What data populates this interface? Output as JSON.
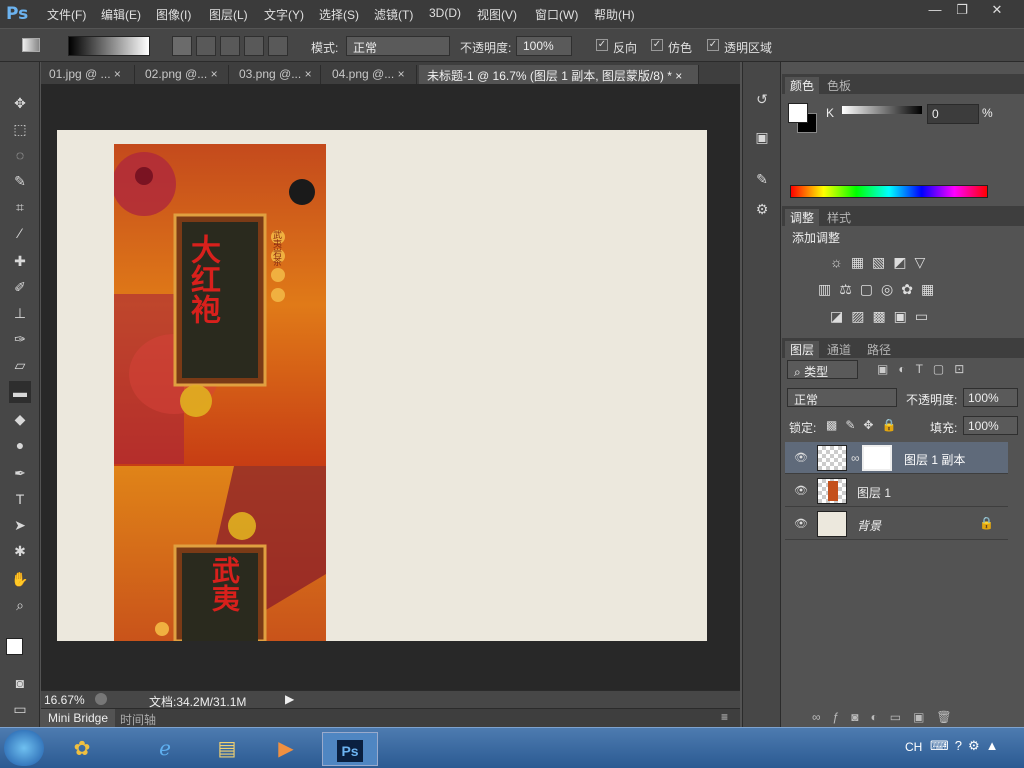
{
  "app": {
    "logo": "Ps"
  },
  "menu": [
    "文件(F)",
    "编辑(E)",
    "图像(I)",
    "图层(L)",
    "文字(Y)",
    "选择(S)",
    "滤镜(T)",
    "3D(D)",
    "视图(V)",
    "窗口(W)",
    "帮助(H)"
  ],
  "window_controls": {
    "minimize": "—",
    "restore": "❐",
    "close": "✕"
  },
  "options": {
    "mode_label": "模式:",
    "mode_value": "正常",
    "opacity_label": "不透明度:",
    "opacity_value": "100%",
    "reverse_label": "反向",
    "dither_label": "仿色",
    "transparency_label": "透明区域"
  },
  "tabs": [
    {
      "label": "01.jpg @ ...",
      "close": "×"
    },
    {
      "label": "02.png @...",
      "close": "×"
    },
    {
      "label": "03.png @...",
      "close": "×"
    },
    {
      "label": "04.png @...",
      "close": "×"
    },
    {
      "label": "未标题-1 @ 16.7% (图层 1 副本, 图层蒙版/8) *",
      "close": "×"
    }
  ],
  "artwork": {
    "text_top": "大红袍",
    "text_bottom": "武夷",
    "side_text": "武夷岩茶"
  },
  "status": {
    "zoom": "16.67%",
    "doc_info": "文档:34.2M/31.1M"
  },
  "bottom_tabs": {
    "mini_bridge": "Mini Bridge",
    "timeline": "时间轴"
  },
  "color_panel": {
    "tab_color": "颜色",
    "tab_swatches": "色板",
    "channel": "K",
    "value": "0",
    "unit": "%"
  },
  "adjust_panel": {
    "tab_adjust": "调整",
    "tab_styles": "样式",
    "title": "添加调整"
  },
  "layers_panel": {
    "tab_layers": "图层",
    "tab_channels": "通道",
    "tab_paths": "路径",
    "filter_label": "类型",
    "blend_mode": "正常",
    "opacity_label": "不透明度:",
    "opacity_value": "100%",
    "lock_label": "锁定:",
    "fill_label": "填充:",
    "fill_value": "100%",
    "layers": [
      {
        "name": "图层 1 副本"
      },
      {
        "name": "图层 1"
      },
      {
        "name": "背景"
      }
    ]
  },
  "taskbar": {
    "lang": "CH"
  },
  "colors": {
    "accent": "#6cb3f0",
    "doc_bg": "#ece8dd",
    "selected_layer": "#5f6a7a"
  }
}
